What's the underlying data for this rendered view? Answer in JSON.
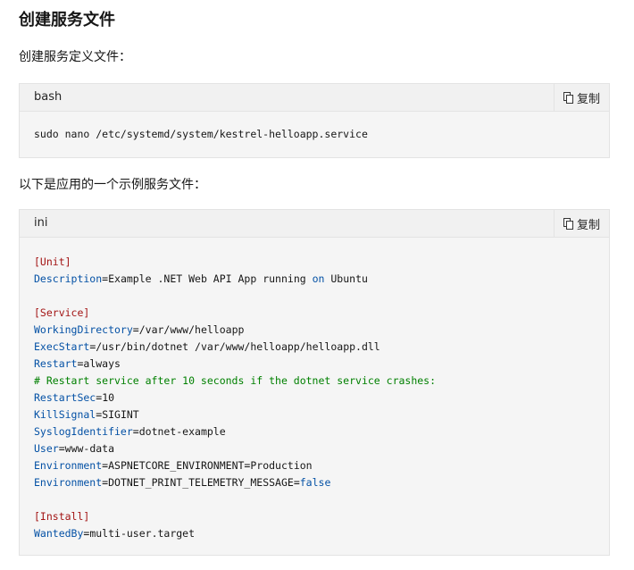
{
  "heading": "创建服务文件",
  "intro1": "创建服务定义文件：",
  "intro2": "以下是应用的一个示例服务文件：",
  "copy_label": "复制",
  "block1": {
    "lang": "bash",
    "code": "sudo nano /etc/systemd/system/kestrel-helloapp.service"
  },
  "block2": {
    "lang": "ini",
    "lines": [
      {
        "type": "section",
        "text": "[Unit]"
      },
      {
        "type": "kv",
        "key": "Description",
        "eq": "=",
        "value": "Example .NET Web API App running ",
        "kw": "on",
        "value2": " Ubuntu"
      },
      {
        "type": "blank"
      },
      {
        "type": "section",
        "text": "[Service]"
      },
      {
        "type": "kv",
        "key": "WorkingDirectory",
        "eq": "=",
        "value": "/var/www/helloapp"
      },
      {
        "type": "kv",
        "key": "ExecStart",
        "eq": "=",
        "value": "/usr/bin/dotnet /var/www/helloapp/helloapp.dll"
      },
      {
        "type": "kv",
        "key": "Restart",
        "eq": "=",
        "value": "always"
      },
      {
        "type": "comment",
        "text": "# Restart service after 10 seconds if the dotnet service crashes:"
      },
      {
        "type": "kv",
        "key": "RestartSec",
        "eq": "=",
        "value": "10"
      },
      {
        "type": "kv",
        "key": "KillSignal",
        "eq": "=",
        "value": "SIGINT"
      },
      {
        "type": "kv",
        "key": "SyslogIdentifier",
        "eq": "=",
        "value": "dotnet-example"
      },
      {
        "type": "kv",
        "key": "User",
        "eq": "=",
        "value": "www-data"
      },
      {
        "type": "kv",
        "key": "Environment",
        "eq": "=",
        "value": "ASPNETCORE_ENVIRONMENT=Production"
      },
      {
        "type": "kv",
        "key": "Environment",
        "eq": "=",
        "value": "DOTNET_PRINT_TELEMETRY_MESSAGE=",
        "kw": "false"
      },
      {
        "type": "blank"
      },
      {
        "type": "section",
        "text": "[Install]"
      },
      {
        "type": "kv",
        "key": "WantedBy",
        "eq": "=",
        "value": "multi-user.target"
      }
    ]
  },
  "colors": {
    "section": "#a31515",
    "key": "#0451a5",
    "comment": "#008000",
    "code_bg": "#f5f5f5",
    "header_bg": "#f1f1f1"
  },
  "icons": {
    "copy": "copy-icon"
  }
}
